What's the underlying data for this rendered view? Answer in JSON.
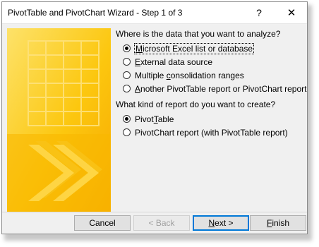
{
  "window": {
    "title": "PivotTable and PivotChart Wizard - Step 1 of 3",
    "help_glyph": "?",
    "close_glyph": "✕"
  },
  "data_source": {
    "question": "Where is the data that you want to analyze?",
    "options": [
      {
        "pre": "",
        "mnemonic": "M",
        "post": "icrosoft Excel list or database",
        "selected": true
      },
      {
        "pre": "",
        "mnemonic": "E",
        "post": "xternal data source",
        "selected": false
      },
      {
        "pre": "Multiple ",
        "mnemonic": "c",
        "post": "onsolidation ranges",
        "selected": false
      },
      {
        "pre": "",
        "mnemonic": "A",
        "post": "nother PivotTable report or PivotChart report",
        "selected": false
      }
    ]
  },
  "report_kind": {
    "question": "What kind of report do you want to create?",
    "options": [
      {
        "pre": "Pivot",
        "mnemonic": "T",
        "post": "able",
        "selected": true
      },
      {
        "pre": "PivotChart report (with PivotTable report)",
        "mnemonic": "",
        "post": "",
        "selected": false
      }
    ]
  },
  "buttons": {
    "cancel": "Cancel",
    "back": "< Back",
    "next_mnemonic": "N",
    "next_rest": "ext >",
    "finish_mnemonic": "F",
    "finish_rest": "inish"
  },
  "colors": {
    "art_yellow": "#fcd116",
    "art_orange": "#f7a800",
    "accent_focus": "#0078d7"
  },
  "icons": [
    "help-icon",
    "close-icon",
    "wizard-illustration"
  ]
}
